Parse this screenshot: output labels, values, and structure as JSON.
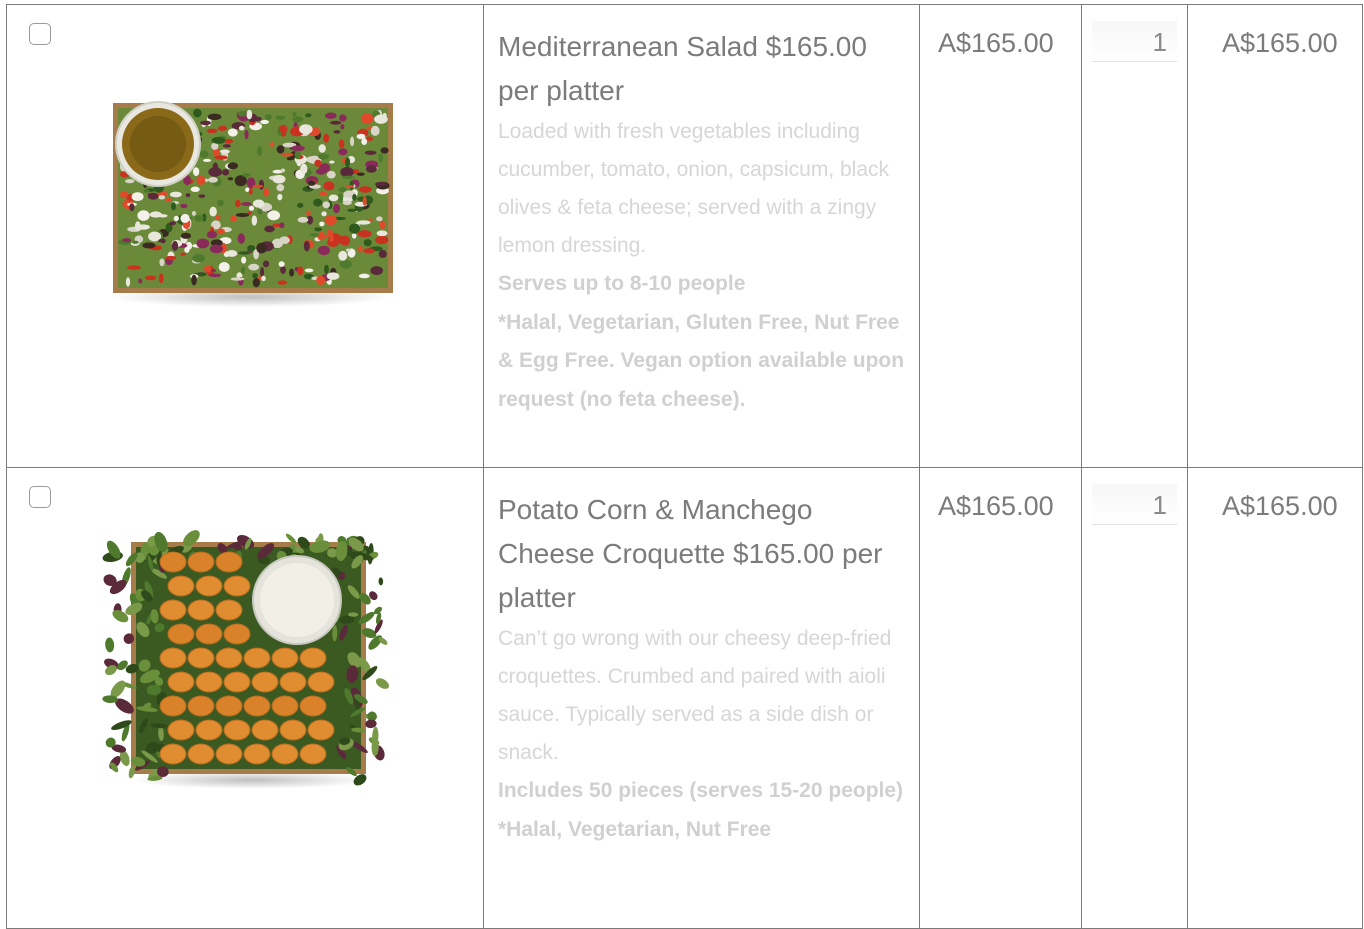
{
  "items": [
    {
      "title": "Mediterranean Salad $165.00 per platter",
      "description": "Loaded with fresh vegetables including cucumber, tomato, onion, capsicum, black olives & feta cheese; served with a zingy lemon dressing.",
      "bold_lines": [
        "Serves up to 8-10 people",
        "*Halal, Vegetarian, Gluten Free, Nut Free & Egg Free. Vegan option available upon request (no feta cheese)."
      ],
      "price": "A$165.00",
      "quantity": "1",
      "subtotal": "A$165.00"
    },
    {
      "title": "Potato Corn & Manchego Cheese Croquette $165.00 per platter",
      "description": "Can’t go wrong with our cheesy deep-fried croquettes. Crumbed and paired with aioli sauce. Typically served as a side dish or snack.",
      "bold_lines": [
        "Includes 50 pieces (serves 15-20 people)",
        "*Halal, Vegetarian, Nut Free"
      ],
      "price": "A$165.00",
      "quantity": "1",
      "subtotal": "A$165.00"
    }
  ],
  "colors": {
    "border": "#7a7a7a",
    "title": "#7b7b7b",
    "muted": "#d6d6d6"
  },
  "icons": [
    "checkbox",
    "salad-platter-image",
    "croquette-platter-image"
  ]
}
